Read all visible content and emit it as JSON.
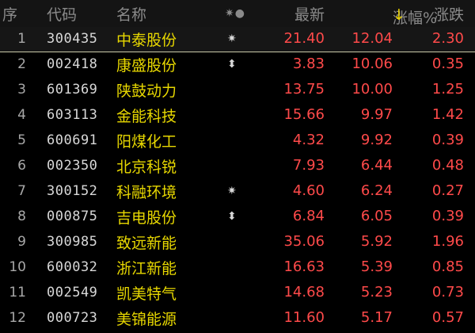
{
  "header": {
    "seq": "序",
    "code": "代码",
    "name": "名称",
    "icons": "✷●",
    "price": "最新",
    "pct": "涨幅%",
    "pct_sort": "↓",
    "change": "涨跌"
  },
  "rows": [
    {
      "seq": "1",
      "code": "300435",
      "name": "中泰股份",
      "flag": "✷",
      "price": "21.40",
      "pct": "12.04",
      "change": "2.30"
    },
    {
      "seq": "2",
      "code": "002418",
      "name": "康盛股份",
      "flag": "⬍",
      "price": "3.83",
      "pct": "10.06",
      "change": "0.35"
    },
    {
      "seq": "3",
      "code": "601369",
      "name": "陕鼓动力",
      "flag": "",
      "price": "13.75",
      "pct": "10.00",
      "change": "1.25"
    },
    {
      "seq": "4",
      "code": "603113",
      "name": "金能科技",
      "flag": "",
      "price": "15.66",
      "pct": "9.97",
      "change": "1.42"
    },
    {
      "seq": "5",
      "code": "600691",
      "name": "阳煤化工",
      "flag": "",
      "price": "4.32",
      "pct": "9.92",
      "change": "0.39"
    },
    {
      "seq": "6",
      "code": "002350",
      "name": "北京科锐",
      "flag": "",
      "price": "7.93",
      "pct": "6.44",
      "change": "0.48"
    },
    {
      "seq": "7",
      "code": "300152",
      "name": "科融环境",
      "flag": "✷",
      "price": "4.60",
      "pct": "6.24",
      "change": "0.27"
    },
    {
      "seq": "8",
      "code": "000875",
      "name": "吉电股份",
      "flag": "⬍",
      "price": "6.84",
      "pct": "6.05",
      "change": "0.39"
    },
    {
      "seq": "9",
      "code": "300985",
      "name": "致远新能",
      "flag": "",
      "price": "35.06",
      "pct": "5.92",
      "change": "1.96"
    },
    {
      "seq": "10",
      "code": "600032",
      "name": "浙江新能",
      "flag": "",
      "price": "16.63",
      "pct": "5.39",
      "change": "0.85"
    },
    {
      "seq": "11",
      "code": "002549",
      "name": "凯美特气",
      "flag": "",
      "price": "14.68",
      "pct": "5.23",
      "change": "0.73"
    },
    {
      "seq": "12",
      "code": "000723",
      "name": "美锦能源",
      "flag": "",
      "price": "11.60",
      "pct": "5.17",
      "change": "0.57"
    }
  ],
  "colors": {
    "background": "#000000",
    "header_text": "#8a8a8a",
    "name": "#e8d800",
    "up": "#ff4a4a",
    "sort_arrow": "#e8d000"
  }
}
